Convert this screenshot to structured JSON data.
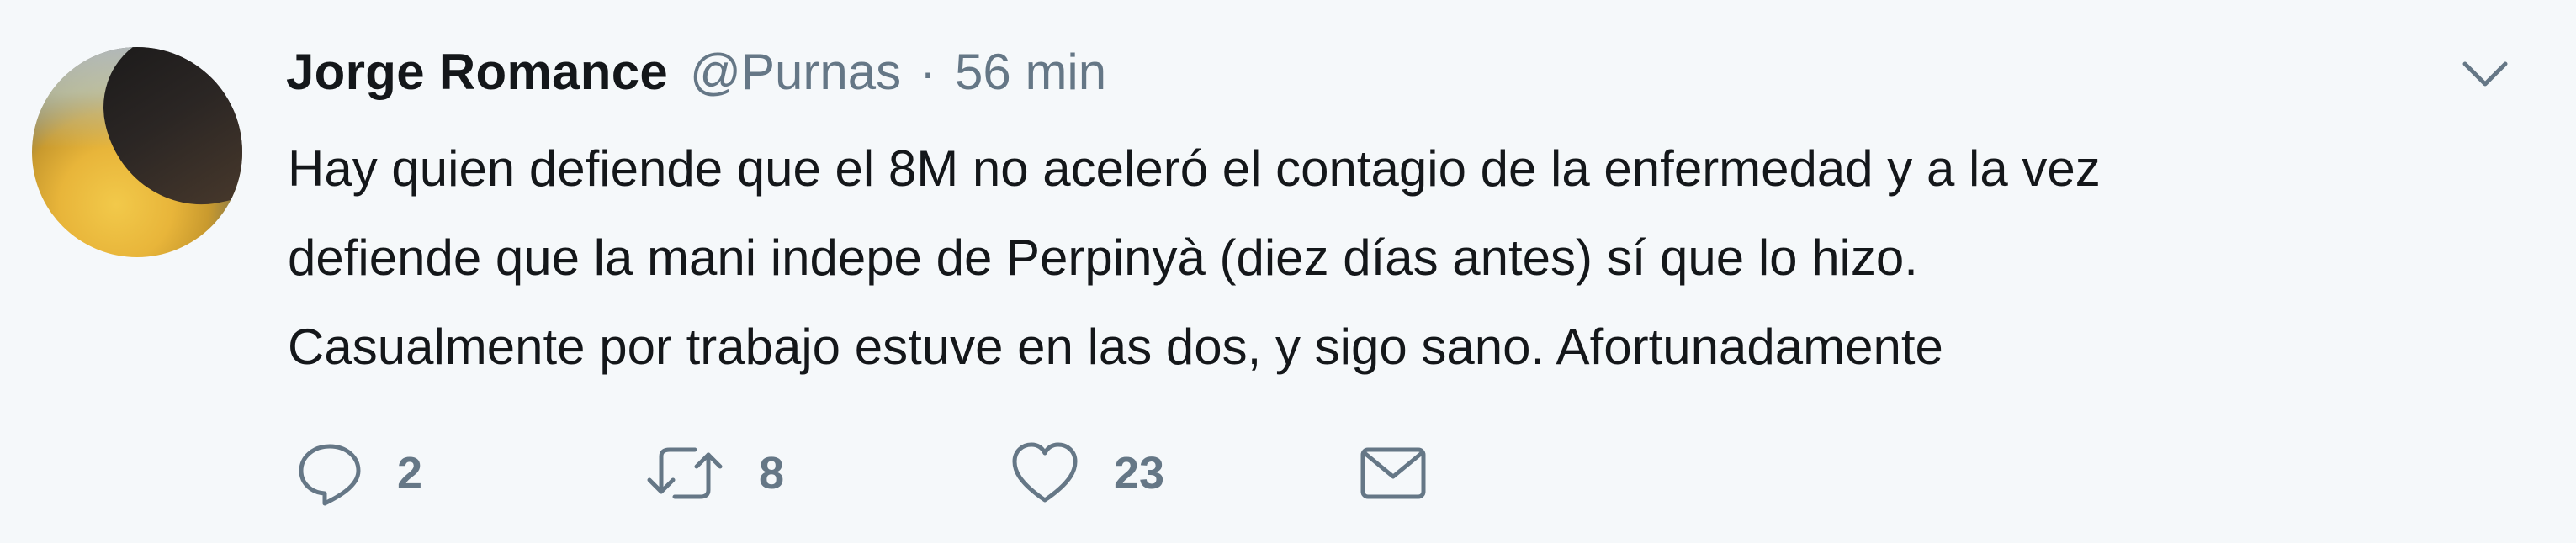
{
  "tweet": {
    "author_name": "Jorge Romance",
    "handle": "@Purnas",
    "separator": "·",
    "time": "56 min",
    "text_lines": [
      "Hay quien defiende que el 8M no aceleró el contagio de la enfermedad y a la vez",
      "defiende que la mani indepe de Perpinyà (diez días antes) sí que lo hizo.",
      "Casualmente por trabajo estuve en las dos, y sigo sano. Afortunadamente"
    ],
    "actions": {
      "reply_icon": "reply-icon",
      "reply_count": "2",
      "retweet_icon": "retweet-icon",
      "retweet_count": "8",
      "like_icon": "heart-icon",
      "like_count": "23",
      "dm_icon": "envelope-icon"
    },
    "menu_icon": "chevron-down-icon"
  },
  "colors": {
    "background": "#f5f8fa",
    "text": "#14171a",
    "secondary": "#657786"
  }
}
